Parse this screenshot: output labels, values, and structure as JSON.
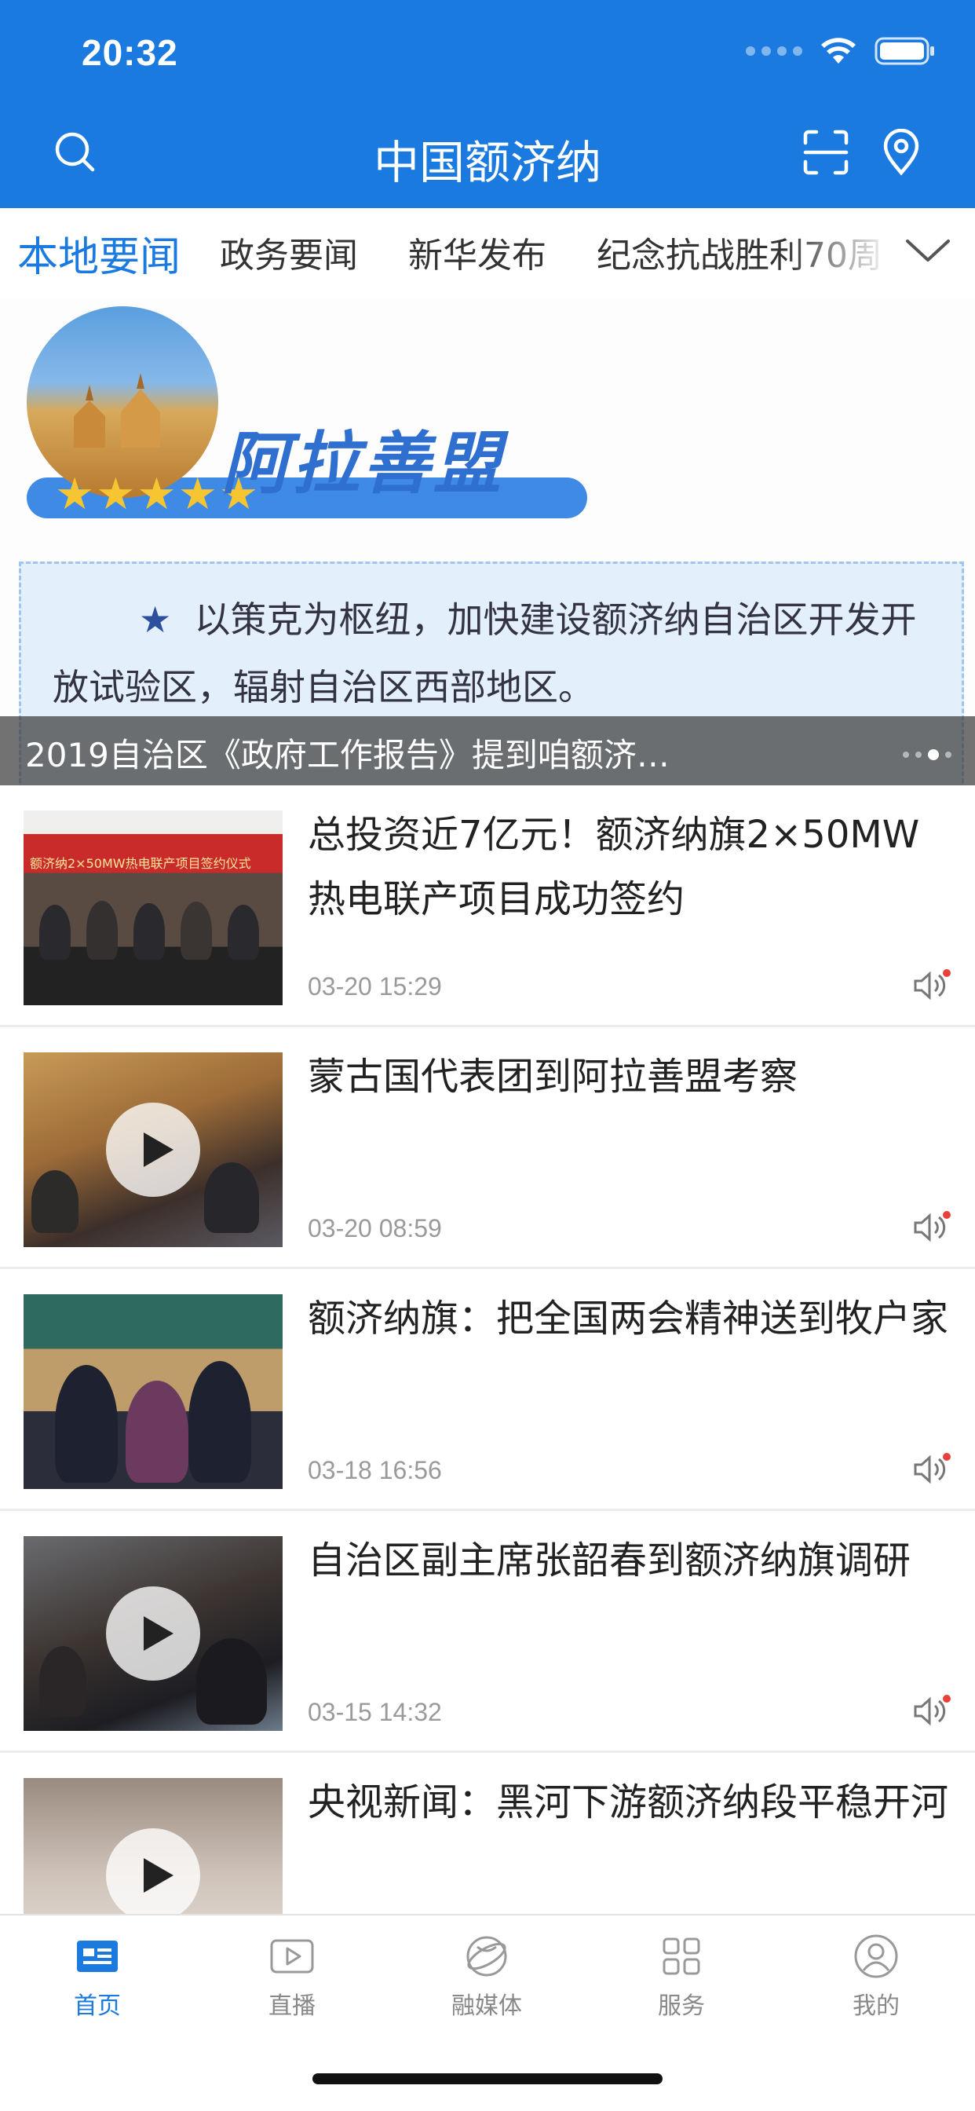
{
  "status": {
    "time": "20:32"
  },
  "header": {
    "title": "中国额济纳"
  },
  "tabs": [
    {
      "label": "本地要闻",
      "active": true
    },
    {
      "label": "政务要闻",
      "active": false
    },
    {
      "label": "新华发布",
      "active": false
    },
    {
      "label": "纪念抗战胜利70周",
      "active": false
    }
  ],
  "banner": {
    "brand": "阿拉善盟",
    "stars": "★★★★★",
    "star_mark": "★",
    "text": "以策克为枢纽，加快建设额济纳自治区开发开放试验区，辐射自治区西部地区。",
    "caption": "2019自治区《政府工作报告》提到咱额济…",
    "slide_count": 4,
    "active_slide": 3
  },
  "news": [
    {
      "title": "总投资近7亿元！额济纳旗2×50MW热电联产项目成功签约",
      "time": "03-20 15:29",
      "video": false,
      "thumb_text": "额济纳2×50MW热电联产项目签约仪式"
    },
    {
      "title": "蒙古国代表团到阿拉善盟考察",
      "time": "03-20 08:59",
      "video": true
    },
    {
      "title": "额济纳旗：把全国两会精神送到牧户家",
      "time": "03-18 16:56",
      "video": false
    },
    {
      "title": "自治区副主席张韶春到额济纳旗调研",
      "time": "03-15 14:32",
      "video": true
    },
    {
      "title": "央视新闻：黑河下游额济纳段平稳开河",
      "time": "",
      "video": true
    }
  ],
  "tabbar": [
    {
      "label": "首页",
      "icon": "home-news-icon",
      "active": true
    },
    {
      "label": "直播",
      "icon": "live-play-icon",
      "active": false
    },
    {
      "label": "融媒体",
      "icon": "media-globe-icon",
      "active": false
    },
    {
      "label": "服务",
      "icon": "grid-services-icon",
      "active": false
    },
    {
      "label": "我的",
      "icon": "profile-icon",
      "active": false
    }
  ],
  "colors": {
    "primary": "#1a7ae0",
    "badge": "#e8413a"
  }
}
